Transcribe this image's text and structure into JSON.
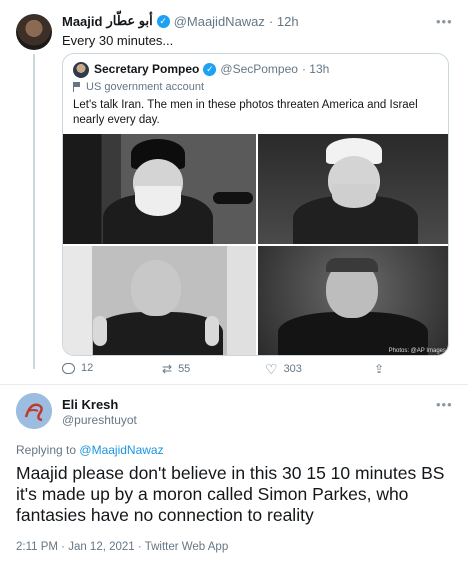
{
  "tweet1": {
    "name": "Maajid",
    "name_ar": "أبو عطّار",
    "handle": "@MaajidNawaz",
    "time": "· 12h",
    "text": "Every 30 minutes...",
    "more": "•••"
  },
  "quote": {
    "name": "Secretary Pompeo",
    "handle": "@SecPompeo",
    "time": "· 13h",
    "gov_label": "US government account",
    "text": "Let's talk Iran. The men in these photos threaten America and Israel nearly every day.",
    "photo_credit": "Photos: @AP Images"
  },
  "actions": {
    "replies": "12",
    "retweets": "55",
    "likes": "303"
  },
  "tweet2": {
    "name": "Eli Kresh",
    "handle": "@pureshtuyot",
    "replying_prefix": "Replying to",
    "replying_to": "@MaajidNawaz",
    "text": "Maajid please don't believe in this 30 15 10 minutes BS it's made up by a moron called Simon Parkes, who fantasies have no connection to reality",
    "meta": "2:11 PM · Jan 12, 2021 · Twitter Web App",
    "more": "•••"
  },
  "colors": {
    "link": "#1b95e0",
    "verified": "#1da1f2",
    "muted": "#657786"
  }
}
